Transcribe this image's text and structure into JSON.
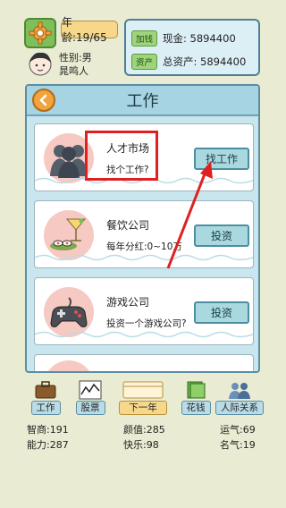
{
  "header": {
    "age": "年龄:19/65",
    "gender": "性别:男",
    "name": "晁鸣人",
    "cash_tag": "加钱",
    "cash": "现金: 5894400",
    "assets_tag": "资产",
    "total_assets": "总资产: 5894400"
  },
  "panel": {
    "title": "工作",
    "cards": [
      {
        "title": "人才市场",
        "subtitle": "找个工作?",
        "button": "找工作",
        "icon": "people-silhouette-icon"
      },
      {
        "title": "餐饮公司",
        "subtitle": "每年分红:0~10万",
        "button": "投资",
        "icon": "cocktail-sushi-icon"
      },
      {
        "title": "游戏公司",
        "subtitle": "投资一个游戏公司?",
        "button": "投资",
        "icon": "gamepad-icon"
      }
    ]
  },
  "toolbar": {
    "work": "工作",
    "stocks": "股票",
    "next_year": "下一年",
    "spend": "花钱",
    "relations": "人际关系"
  },
  "stats": {
    "intellect": "智商:191",
    "looks": "颜值:285",
    "luck": "运气:69",
    "ability": "能力:287",
    "happiness": "快乐:98",
    "fame": "名气:19"
  },
  "colors": {
    "background": "#e9ecd2",
    "panel": "#c9e6ee",
    "highlight": "#e02020",
    "button": "#a9d8df"
  }
}
